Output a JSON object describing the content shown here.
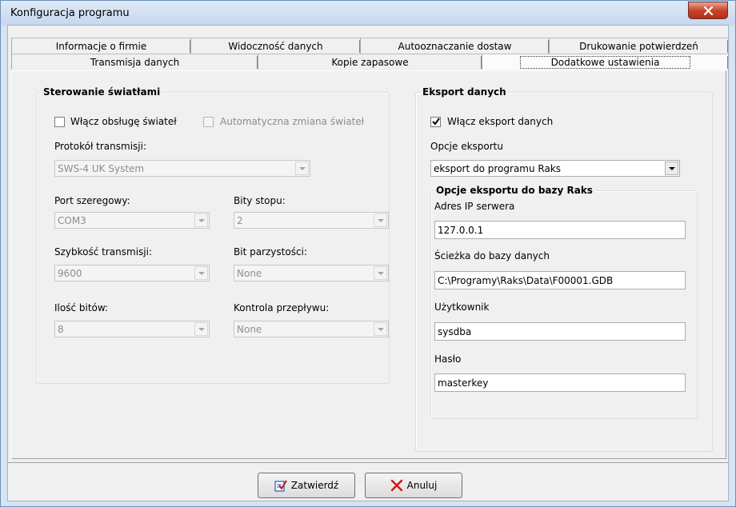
{
  "window": {
    "title": "Konfiguracja programu"
  },
  "tabs": {
    "row1": [
      "Informacje o firmie",
      "Widoczność danych",
      "Autooznaczanie dostaw",
      "Drukowanie potwierdzeń"
    ],
    "row2": [
      "Transmisja danych",
      "Kopie zapasowe",
      "Dodatkowe ustawienia"
    ],
    "active": "Dodatkowe ustawienia"
  },
  "lights": {
    "title": "Sterowanie światłami",
    "enable_label": "Włącz obsługę świateł",
    "enable_checked": false,
    "auto_change_label": "Automatyczna zmiana świateł",
    "auto_change_checked": false,
    "protocol_label": "Protokół transmisji:",
    "protocol_value": "SWS-4 UK System",
    "port_label": "Port szeregowy:",
    "port_value": "COM3",
    "stop_bits_label": "Bity stopu:",
    "stop_bits_value": "2",
    "baud_label": "Szybkość transmisji:",
    "baud_value": "9600",
    "parity_label": "Bit parzystości:",
    "parity_value": "None",
    "data_bits_label": "Ilość bitów:",
    "data_bits_value": "8",
    "flow_label": "Kontrola przepływu:",
    "flow_value": "None"
  },
  "export": {
    "title": "Eksport danych",
    "enable_label": "Włącz eksport danych",
    "enable_checked": true,
    "options_label": "Opcje eksportu",
    "options_value": "eksport do programu Raks",
    "raks": {
      "title": "Opcje eksportu do bazy Raks",
      "ip_label": "Adres IP serwera",
      "ip_value": "127.0.0.1",
      "path_label": "Ścieżka do bazy danych",
      "path_value": "C:\\Programy\\Raks\\Data\\F00001.GDB",
      "user_label": "Użytkownik",
      "user_value": "sysdba",
      "password_label": "Hasło",
      "password_value": "masterkey"
    }
  },
  "footer": {
    "confirm_label": "Zatwierdź",
    "cancel_label": "Anuluj"
  },
  "icons": {
    "close": "close-icon",
    "confirm": "confirm-check-icon",
    "cancel": "cancel-x-icon",
    "checkbox_check": "check-icon",
    "dropdown": "chevron-down-icon"
  },
  "colors": {
    "titlebar": "#c6d8ef",
    "close_button": "#c8462c",
    "cancel_x": "#d21414",
    "confirm_icon": "#2a5db0"
  }
}
